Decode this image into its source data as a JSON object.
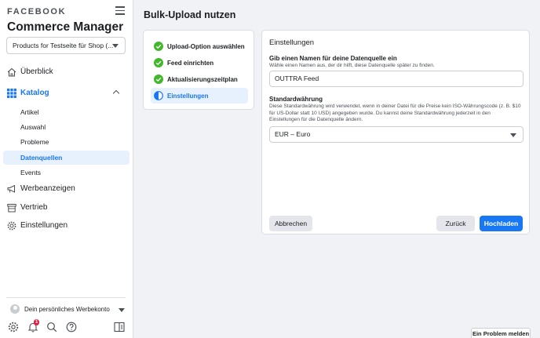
{
  "sidebar": {
    "brand": "FACEBOOK",
    "app_title": "Commerce Manager",
    "catalog_selector": "Products for Testseite für Shop (...",
    "nav": {
      "overview": "Überblick",
      "catalog": "Katalog",
      "catalog_sub": [
        "Artikel",
        "Auswahl",
        "Probleme",
        "Datenquellen",
        "Events"
      ],
      "ads": "Werbeanzeigen",
      "sales": "Vertrieb",
      "settings": "Einstellungen"
    },
    "account_label": "Dein persönliches Werbekonto",
    "notification_count": "1"
  },
  "main": {
    "page_title": "Bulk-Upload nutzen",
    "steps": [
      {
        "label": "Upload-Option auswählen",
        "state": "done"
      },
      {
        "label": "Feed einrichten",
        "state": "done"
      },
      {
        "label": "Aktualisierungszeitplan",
        "state": "done"
      },
      {
        "label": "Einstellungen",
        "state": "current"
      }
    ],
    "panel": {
      "title": "Einstellungen",
      "name_label": "Gib einen Namen für deine Datenquelle ein",
      "name_help": "Wähle einen Namen aus, der dir hilft, diese Datenquelle später zu finden.",
      "name_value": "OUTTRA Feed",
      "currency_label": "Standardwährung",
      "currency_help": "Diese Standardwährung wird verwendet, wenn in deiner Datei für die Preise kein ISO-Währungscode (z. B. $10 für US-Dollar statt 10 USD) angegeben wurde. Du kannst deine Standardwährung jederzeit in den Einstellungen für die Datenquelle ändern.",
      "currency_value": "EUR – Euro",
      "cancel": "Abbrechen",
      "back": "Zurück",
      "upload": "Hochladen"
    },
    "report_problem": "Ein Problem melden"
  },
  "colors": {
    "accent": "#1877f2",
    "success": "#42b72a",
    "active_bg": "#e7f0fd"
  },
  "icons": [
    "home-icon",
    "grid-icon",
    "megaphone-icon",
    "storefront-icon",
    "gear-icon",
    "bell-icon",
    "search-icon",
    "help-icon",
    "panel-toggle-icon",
    "check-circle-icon",
    "half-circle-icon"
  ]
}
